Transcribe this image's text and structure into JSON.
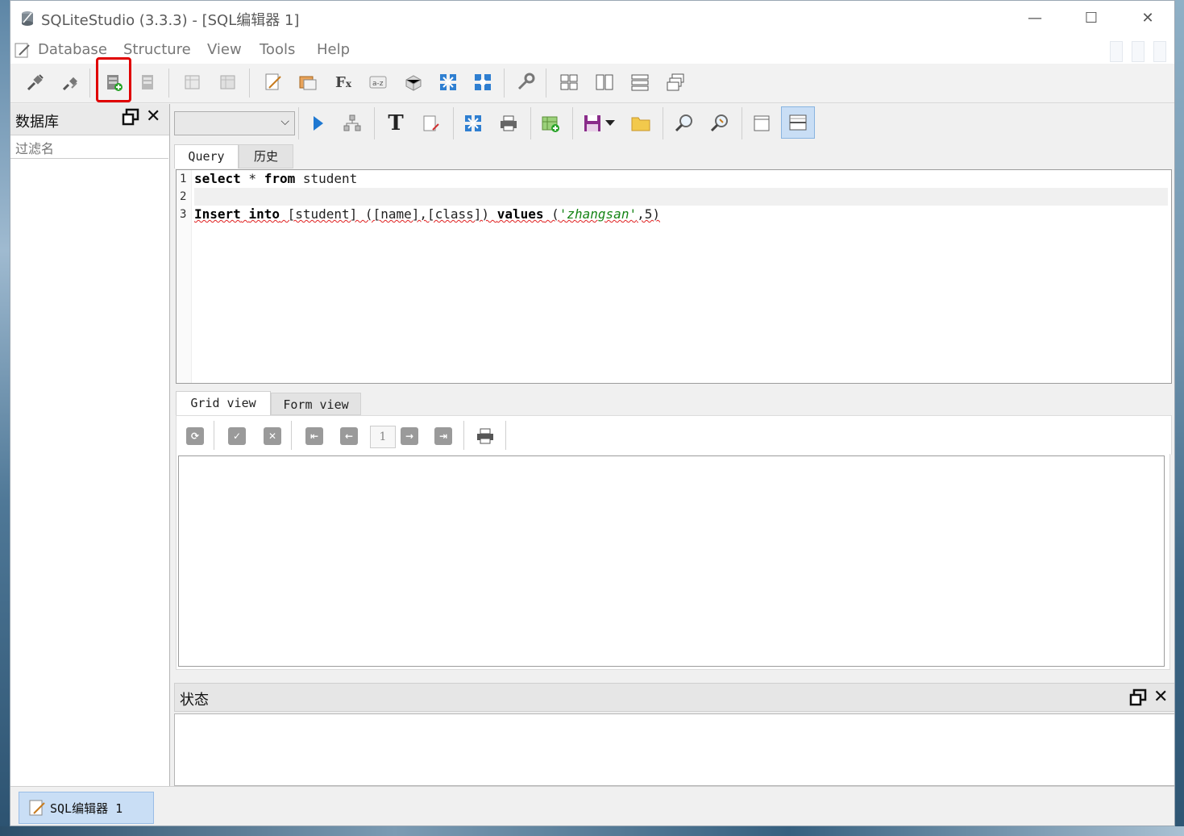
{
  "window": {
    "title": "SQLiteStudio (3.3.3) - [SQL编辑器 1]",
    "controls": {
      "minimize": "—",
      "maximize": "☐",
      "close": "✕"
    }
  },
  "menu": [
    "Database",
    "Structure",
    "View",
    "Tools",
    "Help"
  ],
  "db_panel": {
    "title": "数据库",
    "filter_placeholder": "过滤名"
  },
  "editor": {
    "tabs": [
      "Query",
      "历史"
    ],
    "line_numbers": [
      "1",
      "2",
      "3"
    ],
    "code": {
      "line1": {
        "kw1": "select",
        "rest1": " * ",
        "kw2": "from",
        "rest2": " student"
      },
      "line3": {
        "kw1": "Insert",
        "sp": " ",
        "kw2": "into",
        "mid": " [student] ([name],[class]) ",
        "kw3": "values",
        "open": " (",
        "str": "'zhangsan'",
        "tail": ",5)"
      }
    }
  },
  "results": {
    "tabs": [
      "Grid view",
      "Form view"
    ],
    "page": "1"
  },
  "status_panel": {
    "title": "状态"
  },
  "taskbar": {
    "item": "SQL编辑器 1"
  },
  "highlight_color": "#e00000",
  "active_color": "#c9def5"
}
